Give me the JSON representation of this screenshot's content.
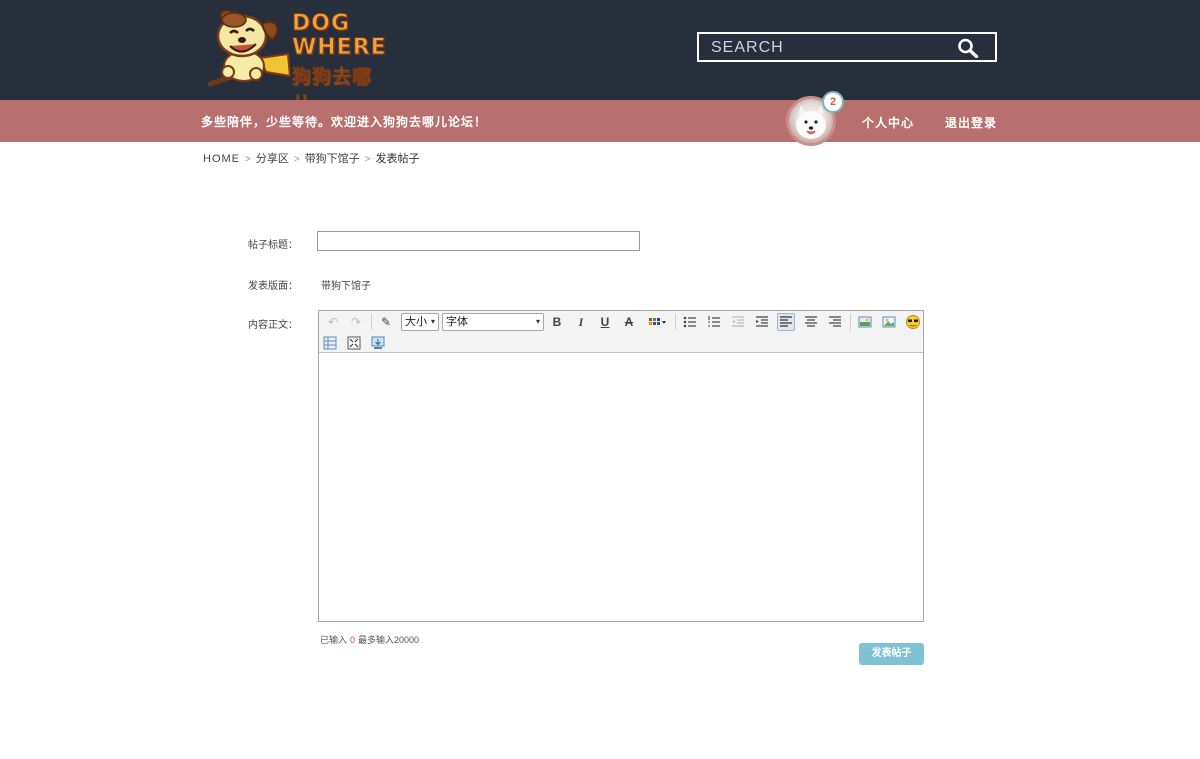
{
  "header": {
    "logo_word_1": "DOG",
    "logo_word_2": "WHERE",
    "logo_cn": "狗狗去哪儿",
    "search_placeholder": "SEARCH"
  },
  "navbar": {
    "slogan": "多些陪伴，少些等待。欢迎进入狗狗去哪儿论坛！",
    "notification_count": "2",
    "profile_link": "个人中心",
    "logout_link": "退出登录"
  },
  "breadcrumb": {
    "home": "HOME",
    "level1": "分享区",
    "level2": "带狗下馆子",
    "current": "发表帖子",
    "separator": ">"
  },
  "form": {
    "title_label": "帖子标题：",
    "title_value": "",
    "board_label": "发表版面：",
    "board_value": "带狗下馆子",
    "content_label": "内容正文：",
    "content_value": ""
  },
  "editor": {
    "size_select": "大小",
    "font_select": "字体",
    "toolbar_icons": [
      "undo-icon",
      "redo-icon",
      "format-painter-icon",
      "bold-icon",
      "italic-icon",
      "underline-icon",
      "strikethrough-icon",
      "text-color-icon",
      "unordered-list-icon",
      "ordered-list-icon",
      "outdent-icon",
      "indent-icon",
      "align-left-icon",
      "align-center-icon",
      "align-right-icon",
      "image-icon",
      "insert-image-icon",
      "emoticon-icon",
      "table-icon",
      "fullscreen-icon",
      "preview-icon"
    ]
  },
  "counter": {
    "prefix": "已输入",
    "count": "0",
    "suffix": "最多输入20000"
  },
  "actions": {
    "submit_label": "发表帖子"
  },
  "colors": {
    "header_bg": "#272e3c",
    "navbar_bg": "#b8706e",
    "submit_bg": "#7ec2d4",
    "count_red": "#e23c3c"
  }
}
